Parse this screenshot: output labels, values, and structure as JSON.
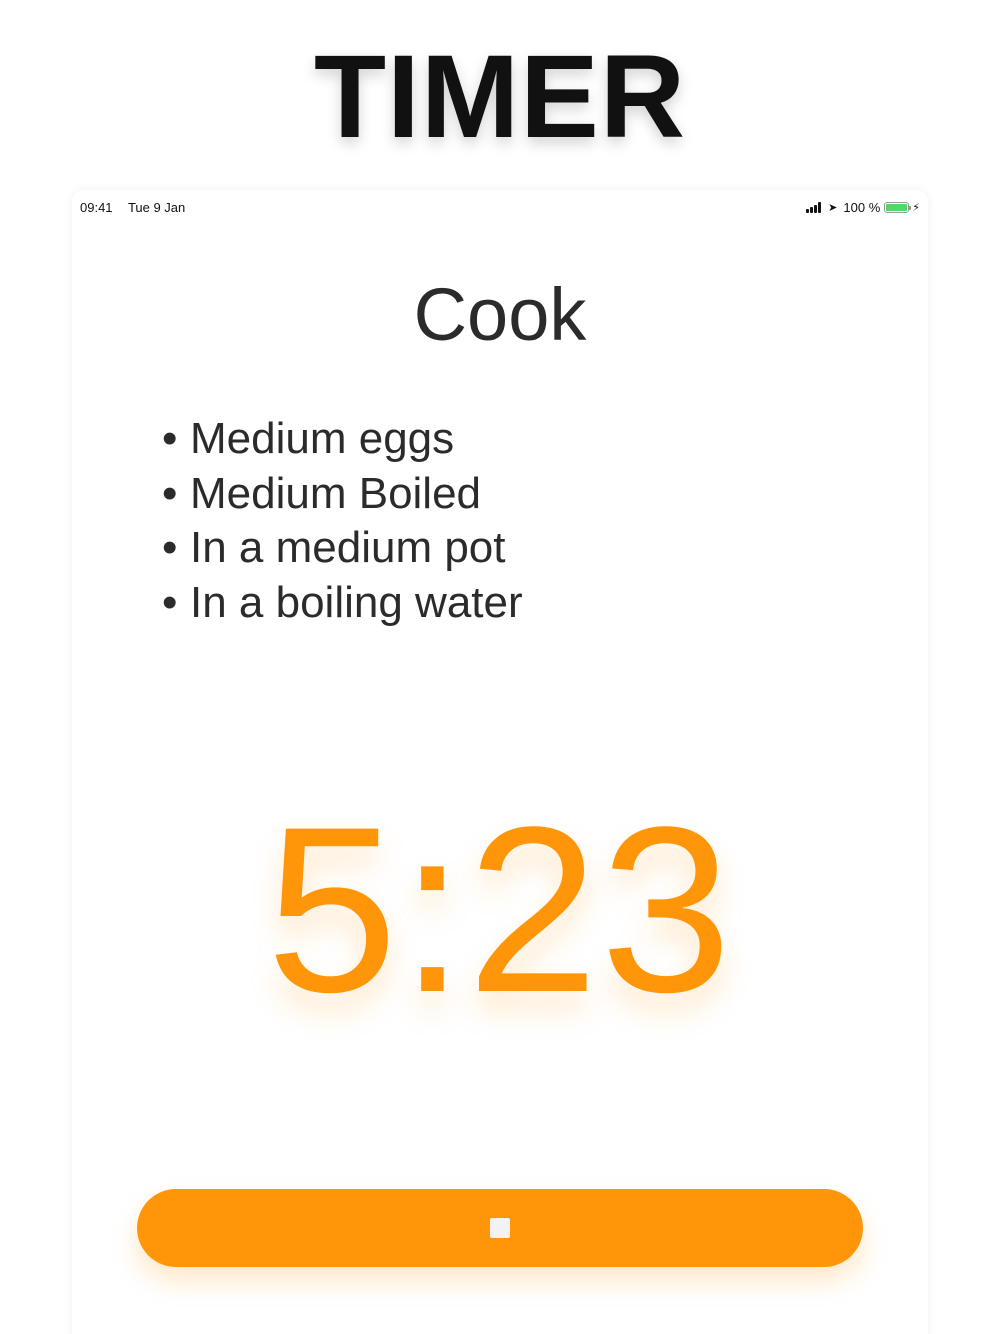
{
  "hero": {
    "title": "TIMER"
  },
  "status_bar": {
    "time": "09:41",
    "date": "Tue 9 Jan",
    "battery_percent": "100 %",
    "battery_level": 1.0,
    "icons": [
      "signal-icon",
      "location-arrow-icon",
      "battery-icon",
      "charging-bolt-icon"
    ]
  },
  "screen": {
    "mode_title": "Cook",
    "details": [
      {
        "text": "Medium eggs"
      },
      {
        "text": "Medium Boiled"
      },
      {
        "text": "In a medium pot"
      },
      {
        "text": "In a boiling water"
      }
    ],
    "timer_value": "5:23",
    "stop_button_icon": "stop-icon"
  },
  "colors": {
    "accent": "#ff9508",
    "battery": "#4cd964",
    "text": "#2b2b2b"
  }
}
